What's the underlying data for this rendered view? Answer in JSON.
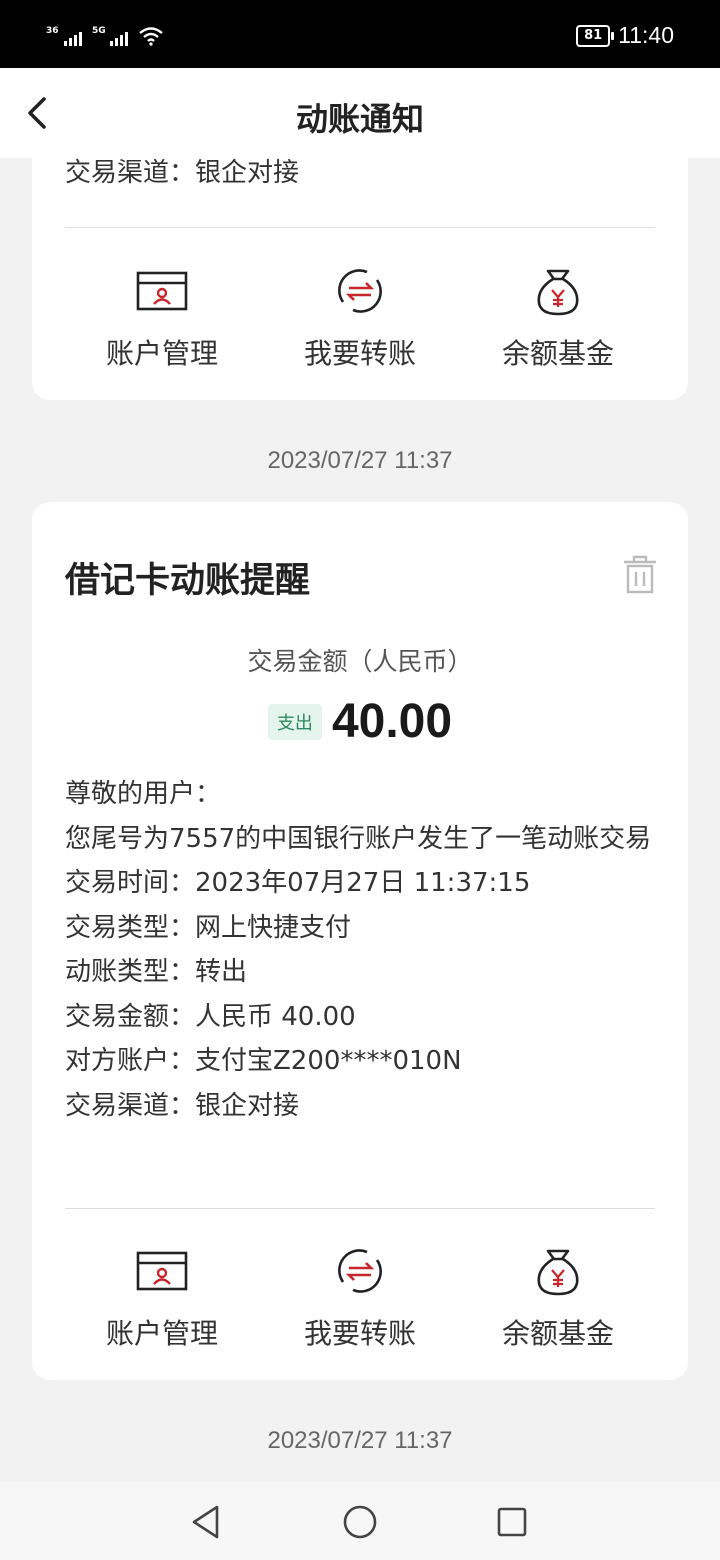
{
  "status_bar": {
    "signal1": "36",
    "signal2": "5G",
    "battery": "81",
    "time": "11:40"
  },
  "header": {
    "title": "动账通知"
  },
  "card_top": {
    "channel_line": "交易渠道：银企对接"
  },
  "actions": [
    {
      "label": "账户管理",
      "icon": "account-card-icon"
    },
    {
      "label": "我要转账",
      "icon": "transfer-icon"
    },
    {
      "label": "余额基金",
      "icon": "money-bag-icon"
    }
  ],
  "timestamps": [
    "2023/07/27 11:37",
    "2023/07/27 11:37"
  ],
  "card_main": {
    "title": "借记卡动账提醒",
    "amount_label": "交易金额（人民币）",
    "badge": "支出",
    "amount": "40.00",
    "greeting": "尊敬的用户：",
    "message": "您尾号为7557的中国银行账户发生了一笔动账交易",
    "lines": [
      "交易时间：2023年07月27日 11:37:15",
      "交易类型：网上快捷支付",
      "动账类型：转出",
      "交易金额：人民币 40.00",
      "对方账户：支付宝Z200****010N",
      "交易渠道：银企对接"
    ]
  },
  "colors": {
    "accent_red": "#c8262c",
    "badge_green": "#2e8a5e"
  }
}
